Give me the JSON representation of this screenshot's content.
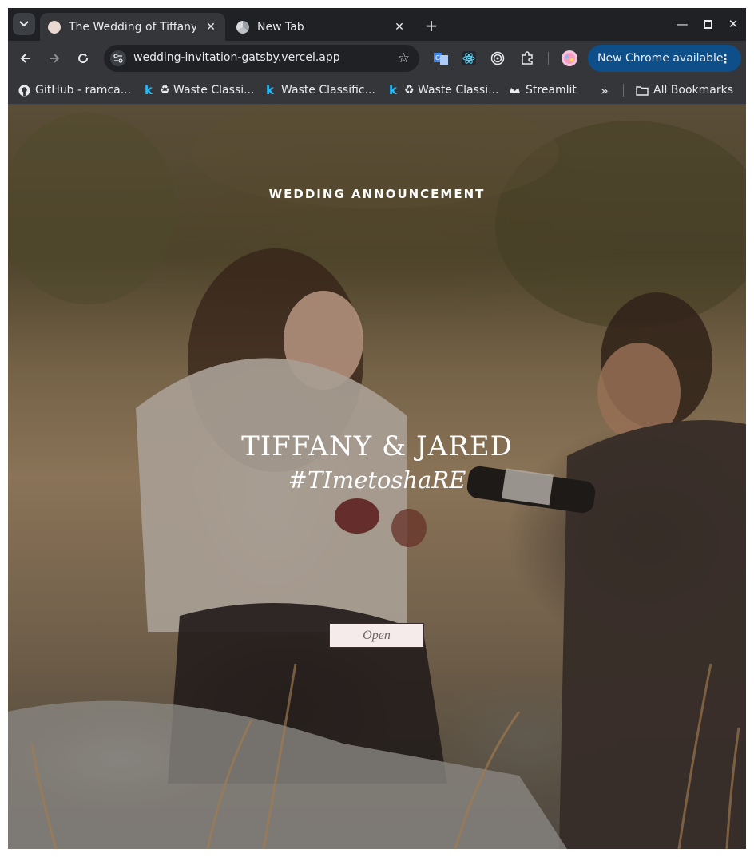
{
  "browser": {
    "tabs": [
      {
        "title": "The Wedding of Tiffany & Jared",
        "active": true
      },
      {
        "title": "New Tab",
        "active": false
      }
    ],
    "url": "wedding-invitation-gatsby.vercel.app",
    "update_chip": "New Chrome available",
    "bookmarks": [
      {
        "label": "GitHub - ramca...",
        "icon": "github-icon"
      },
      {
        "label": "♻ Waste Classi...",
        "icon": "kaggle-icon"
      },
      {
        "label": "Waste Classific...",
        "icon": "kaggle-icon"
      },
      {
        "label": "♻ Waste Classi...",
        "icon": "kaggle-icon"
      },
      {
        "label": "Streamlit",
        "icon": "streamlit-icon"
      }
    ],
    "all_bookmarks": "All Bookmarks"
  },
  "page": {
    "announcement": "WEDDING ANNOUNCEMENT",
    "names": "TIFFANY & JARED",
    "hashtag": "#TImetoshaRE",
    "open_button": "Open"
  },
  "colors": {
    "chrome_dark": "#202124",
    "toolbar": "#35363a",
    "update_chip": "#0e4f8a",
    "button_bg": "#f6ebeb"
  }
}
